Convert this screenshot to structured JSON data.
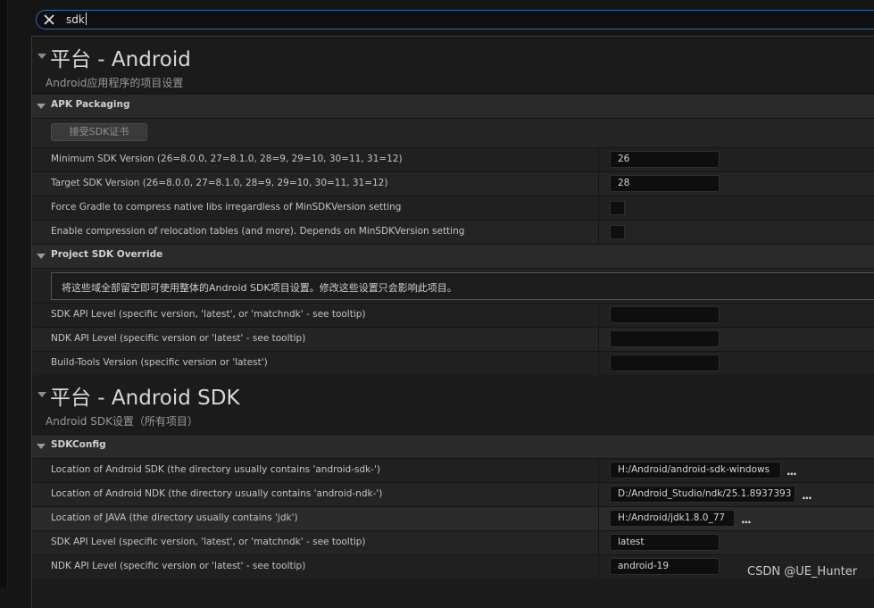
{
  "search": {
    "query": "sdk"
  },
  "sections": [
    {
      "title": "平台 - Android",
      "subtitle": "Android应用程序的项目设置",
      "categories": [
        {
          "title": "APK Packaging",
          "button_label": "接受SDK证书",
          "rows": [
            {
              "label": "Minimum SDK Version (26=8.0.0, 27=8.1.0, 28=9, 29=10, 30=11, 31=12)",
              "value": "26"
            },
            {
              "label": "Target SDK Version (26=8.0.0, 27=8.1.0, 28=9, 29=10, 30=11, 31=12)",
              "value": "28"
            },
            {
              "label": "Force Gradle to compress native libs irregardless of MinSDKVersion setting",
              "checked": false
            },
            {
              "label": "Enable compression of relocation tables (and more). Depends on MinSDKVersion setting",
              "checked": false
            }
          ]
        },
        {
          "title": "Project SDK Override",
          "notice": "将这些域全部留空即可使用整体的Android SDK项目设置。修改这些设置只会影响此项目。",
          "rows": [
            {
              "label": "SDK API Level (specific version, 'latest', or 'matchndk' - see tooltip)",
              "value": ""
            },
            {
              "label": "NDK API Level (specific version or 'latest' - see tooltip)",
              "value": ""
            },
            {
              "label": "Build-Tools Version (specific version or 'latest')",
              "value": ""
            }
          ]
        }
      ]
    },
    {
      "title": "平台 - Android SDK",
      "subtitle": "Android SDK设置（所有项目）",
      "categories": [
        {
          "title": "SDKConfig",
          "rows": [
            {
              "label": "Location of Android SDK (the directory usually contains 'android-sdk-')",
              "value": "H:/Android/android-sdk-windows",
              "browse": "..."
            },
            {
              "label": "Location of Android NDK (the directory usually contains 'android-ndk-')",
              "value": "D:/Android_Studio/ndk/25.1.8937393",
              "browse": "..."
            },
            {
              "label": "Location of JAVA (the directory usually contains 'jdk')",
              "value": "H:/Android/jdk1.8.0_77",
              "browse": "..."
            },
            {
              "label": "SDK API Level (specific version, 'latest', or 'matchndk' - see tooltip)",
              "value": "latest"
            },
            {
              "label": "NDK API Level (specific version or 'latest' - see tooltip)",
              "value": "android-19"
            }
          ]
        }
      ]
    }
  ],
  "watermark": "CSDN @UE_Hunter"
}
